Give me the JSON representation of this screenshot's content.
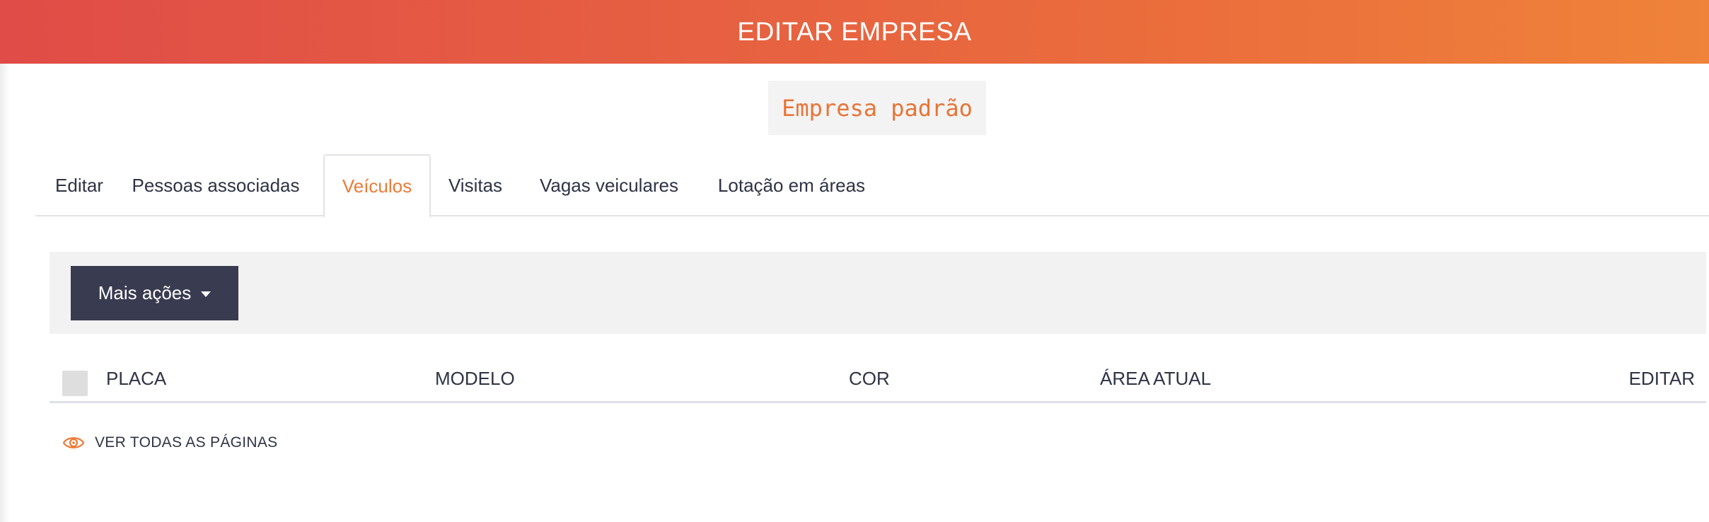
{
  "header": {
    "title": "EDITAR EMPRESA"
  },
  "company": {
    "name": "Empresa padrão"
  },
  "tabs": [
    {
      "label": "Editar",
      "active": false
    },
    {
      "label": "Pessoas associadas",
      "active": false
    },
    {
      "label": "Veículos",
      "active": true
    },
    {
      "label": "Visitas",
      "active": false
    },
    {
      "label": "Vagas veiculares",
      "active": false
    },
    {
      "label": "Lotação em áreas",
      "active": false
    }
  ],
  "actions": {
    "more_label": "Mais ações"
  },
  "table": {
    "columns": [
      "PLACA",
      "MODELO",
      "COR",
      "ÁREA ATUAL",
      "EDITAR"
    ],
    "rows": []
  },
  "footer": {
    "see_all_label": "VER TODAS AS PÁGINAS",
    "see_all_icon": "eye-icon"
  },
  "colors": {
    "accent": "#ee7a36",
    "header_start": "#e04c47",
    "header_end": "#ef833a",
    "button_bg": "#393b50"
  }
}
